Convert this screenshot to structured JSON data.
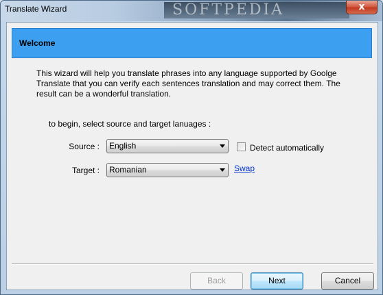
{
  "window": {
    "title": "Translate Wizard",
    "watermark": "SOFTPEDIA",
    "close_label": "x"
  },
  "banner": {
    "title": "Welcome",
    "color": "#3d9ff0"
  },
  "intro_text": "This wizard will help you translate phrases into any language supported by Goolge Translate that you can verify each sentences translation and may correct them. The result can be a wonderful translation.",
  "select_prompt": "to begin, select source and target lanuages :",
  "source": {
    "label": "Source :",
    "value": "English"
  },
  "target": {
    "label": "Target :",
    "value": "Romanian"
  },
  "detect": {
    "label": "Detect automatically",
    "checked": false
  },
  "swap_label": "Swap",
  "buttons": {
    "back": "Back",
    "next": "Next",
    "cancel": "Cancel"
  }
}
